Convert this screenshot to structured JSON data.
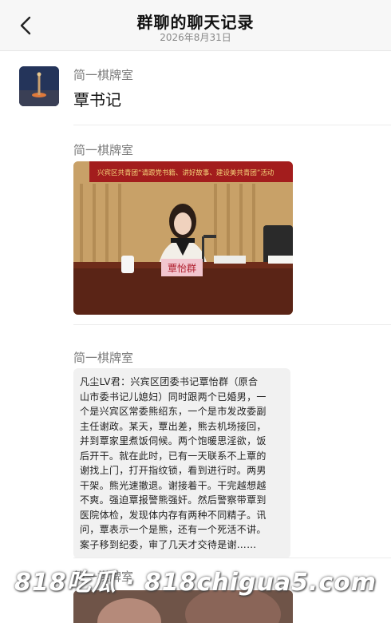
{
  "header": {
    "title": "群聊的聊天记录",
    "date": "2026年8月31日"
  },
  "messages": [
    {
      "sender": "简一棋牌室",
      "type": "text",
      "text": "覃书记"
    },
    {
      "sender": "简一棋牌室",
      "type": "image",
      "image": {
        "banner_text": "兴宾区共青团“请跟党书籍、讲好故事、建设美共青团”活动",
        "nameplate": "覃怡群"
      }
    },
    {
      "sender": "简一棋牌室",
      "type": "long_text",
      "lines": [
        "凡尘LV君：兴宾区团委书记覃怡群（原合",
        "山市委书记儿媳妇）同时跟两个已婚男，一",
        "个是兴宾区常委熊绍东，一个是市发改委副",
        "主任谢政。某天，覃出差，熊去机场接回，",
        "并到覃家里煮饭伺候。两个饱暖思淫欲，饭",
        "后开干。就在此时，已有一天联系不上覃的",
        "谢找上门，打开指纹锁，看到进行时。两男",
        "干架。熊光速撤退。谢接着干。干完越想越",
        "不爽。强迫覃报警熊强奸。然后警察带覃到",
        "医院体检，发现体内存有两种不同精子。讯",
        "问，覃表示一个是熊，还有一个死活不讲。",
        "案子移到纪委，审了几天才交待是谢……"
      ]
    },
    {
      "sender": "简一棋牌室",
      "type": "image"
    }
  ],
  "watermark": "818吃瓜 · 818chigua5.com",
  "icons": {
    "back": "chevron-left-icon"
  },
  "colors": {
    "header_bg": "#f7f7f7",
    "bubble_bg": "#f1f1f1",
    "sender": "#7a7a7a"
  }
}
